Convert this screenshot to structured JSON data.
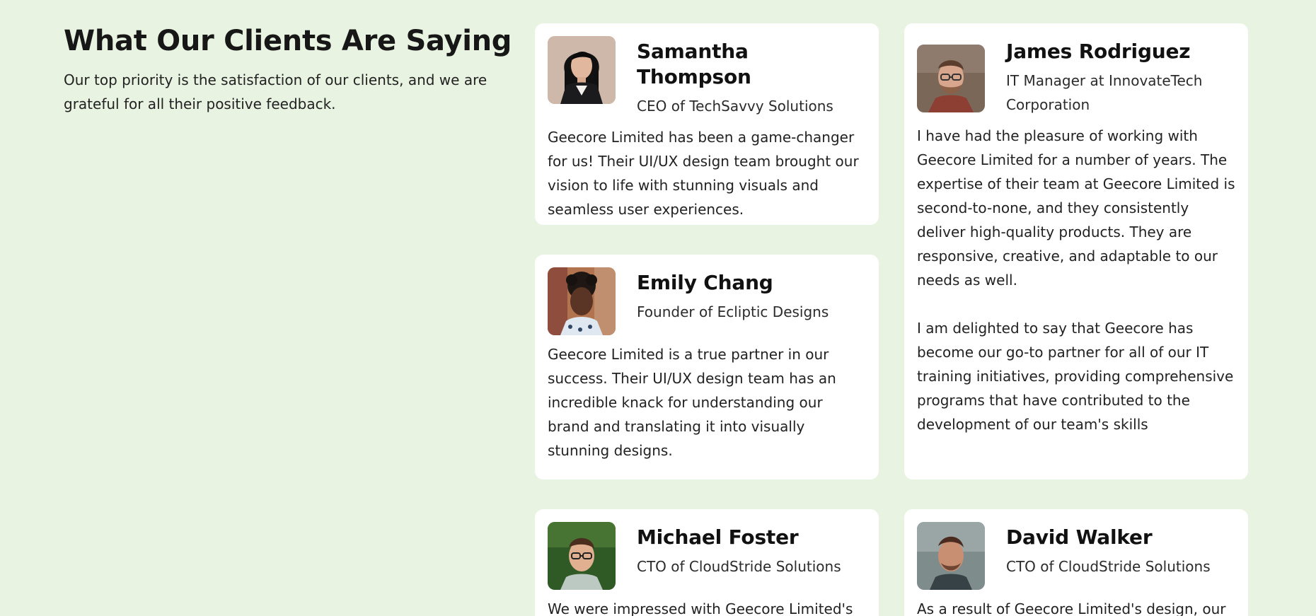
{
  "section": {
    "title": "What Our Clients Are Saying",
    "subtitle": "Our top priority is the satisfaction of our clients, and we are grateful for all their positive feedback."
  },
  "testimonials": [
    {
      "name": "Samantha Thompson",
      "role": "CEO of TechSavvy Solutions",
      "quote": "Geecore Limited has been a game-changer for us! Their UI/UX design team brought our vision to life with stunning visuals and seamless user experiences."
    },
    {
      "name": "James Rodriguez",
      "role": "IT Manager at InnovateTech Corporation",
      "quote": "I have had the pleasure of working with Geecore Limited for a number of years. The expertise of their team at Geecore Limited is second-to-none, and they consistently deliver high-quality products. They are responsive, creative, and adaptable to our needs as well.\n\nI am delighted to say that Geecore has become our go-to partner for all of our IT training initiatives, providing comprehensive programs that have contributed to the development of our team's skills"
    },
    {
      "name": "Emily Chang",
      "role": "Founder of Ecliptic Designs",
      "quote": "Geecore Limited is a true partner in our success. Their UI/UX design team has an incredible knack for understanding our brand and translating it into visually stunning designs."
    },
    {
      "name": "Michael Foster",
      "role": "CTO of CloudStride Solutions",
      "quote": "We were impressed with Geecore Limited's"
    },
    {
      "name": "David Walker",
      "role": "CTO of CloudStride Solutions",
      "quote": "As a result of Geecore Limited's design, our"
    }
  ],
  "colors": {
    "background": "#e8f3e1",
    "card": "#ffffff",
    "text": "#1c1c1c"
  }
}
